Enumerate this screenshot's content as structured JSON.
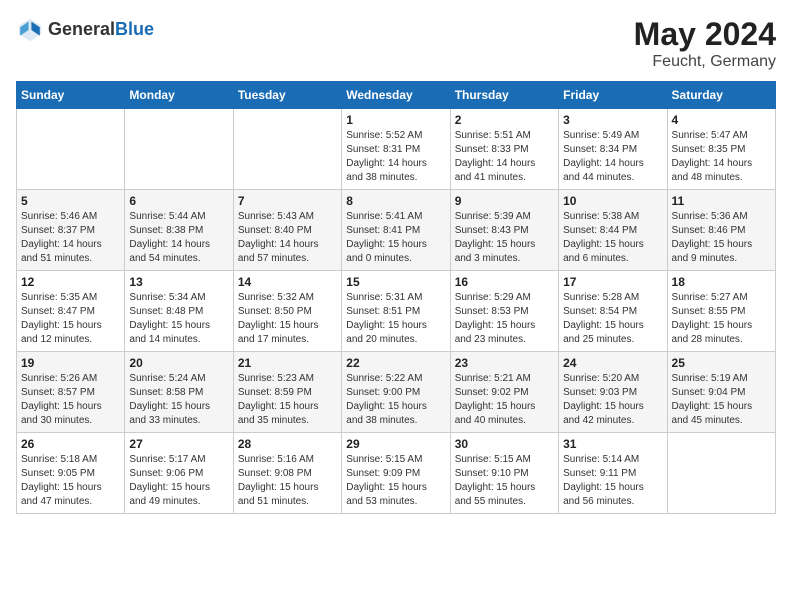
{
  "header": {
    "logo_general": "General",
    "logo_blue": "Blue",
    "title": "May 2024",
    "location": "Feucht, Germany"
  },
  "weekdays": [
    "Sunday",
    "Monday",
    "Tuesday",
    "Wednesday",
    "Thursday",
    "Friday",
    "Saturday"
  ],
  "weeks": [
    [
      {
        "day": "",
        "info": ""
      },
      {
        "day": "",
        "info": ""
      },
      {
        "day": "",
        "info": ""
      },
      {
        "day": "1",
        "info": "Sunrise: 5:52 AM\nSunset: 8:31 PM\nDaylight: 14 hours\nand 38 minutes."
      },
      {
        "day": "2",
        "info": "Sunrise: 5:51 AM\nSunset: 8:33 PM\nDaylight: 14 hours\nand 41 minutes."
      },
      {
        "day": "3",
        "info": "Sunrise: 5:49 AM\nSunset: 8:34 PM\nDaylight: 14 hours\nand 44 minutes."
      },
      {
        "day": "4",
        "info": "Sunrise: 5:47 AM\nSunset: 8:35 PM\nDaylight: 14 hours\nand 48 minutes."
      }
    ],
    [
      {
        "day": "5",
        "info": "Sunrise: 5:46 AM\nSunset: 8:37 PM\nDaylight: 14 hours\nand 51 minutes."
      },
      {
        "day": "6",
        "info": "Sunrise: 5:44 AM\nSunset: 8:38 PM\nDaylight: 14 hours\nand 54 minutes."
      },
      {
        "day": "7",
        "info": "Sunrise: 5:43 AM\nSunset: 8:40 PM\nDaylight: 14 hours\nand 57 minutes."
      },
      {
        "day": "8",
        "info": "Sunrise: 5:41 AM\nSunset: 8:41 PM\nDaylight: 15 hours\nand 0 minutes."
      },
      {
        "day": "9",
        "info": "Sunrise: 5:39 AM\nSunset: 8:43 PM\nDaylight: 15 hours\nand 3 minutes."
      },
      {
        "day": "10",
        "info": "Sunrise: 5:38 AM\nSunset: 8:44 PM\nDaylight: 15 hours\nand 6 minutes."
      },
      {
        "day": "11",
        "info": "Sunrise: 5:36 AM\nSunset: 8:46 PM\nDaylight: 15 hours\nand 9 minutes."
      }
    ],
    [
      {
        "day": "12",
        "info": "Sunrise: 5:35 AM\nSunset: 8:47 PM\nDaylight: 15 hours\nand 12 minutes."
      },
      {
        "day": "13",
        "info": "Sunrise: 5:34 AM\nSunset: 8:48 PM\nDaylight: 15 hours\nand 14 minutes."
      },
      {
        "day": "14",
        "info": "Sunrise: 5:32 AM\nSunset: 8:50 PM\nDaylight: 15 hours\nand 17 minutes."
      },
      {
        "day": "15",
        "info": "Sunrise: 5:31 AM\nSunset: 8:51 PM\nDaylight: 15 hours\nand 20 minutes."
      },
      {
        "day": "16",
        "info": "Sunrise: 5:29 AM\nSunset: 8:53 PM\nDaylight: 15 hours\nand 23 minutes."
      },
      {
        "day": "17",
        "info": "Sunrise: 5:28 AM\nSunset: 8:54 PM\nDaylight: 15 hours\nand 25 minutes."
      },
      {
        "day": "18",
        "info": "Sunrise: 5:27 AM\nSunset: 8:55 PM\nDaylight: 15 hours\nand 28 minutes."
      }
    ],
    [
      {
        "day": "19",
        "info": "Sunrise: 5:26 AM\nSunset: 8:57 PM\nDaylight: 15 hours\nand 30 minutes."
      },
      {
        "day": "20",
        "info": "Sunrise: 5:24 AM\nSunset: 8:58 PM\nDaylight: 15 hours\nand 33 minutes."
      },
      {
        "day": "21",
        "info": "Sunrise: 5:23 AM\nSunset: 8:59 PM\nDaylight: 15 hours\nand 35 minutes."
      },
      {
        "day": "22",
        "info": "Sunrise: 5:22 AM\nSunset: 9:00 PM\nDaylight: 15 hours\nand 38 minutes."
      },
      {
        "day": "23",
        "info": "Sunrise: 5:21 AM\nSunset: 9:02 PM\nDaylight: 15 hours\nand 40 minutes."
      },
      {
        "day": "24",
        "info": "Sunrise: 5:20 AM\nSunset: 9:03 PM\nDaylight: 15 hours\nand 42 minutes."
      },
      {
        "day": "25",
        "info": "Sunrise: 5:19 AM\nSunset: 9:04 PM\nDaylight: 15 hours\nand 45 minutes."
      }
    ],
    [
      {
        "day": "26",
        "info": "Sunrise: 5:18 AM\nSunset: 9:05 PM\nDaylight: 15 hours\nand 47 minutes."
      },
      {
        "day": "27",
        "info": "Sunrise: 5:17 AM\nSunset: 9:06 PM\nDaylight: 15 hours\nand 49 minutes."
      },
      {
        "day": "28",
        "info": "Sunrise: 5:16 AM\nSunset: 9:08 PM\nDaylight: 15 hours\nand 51 minutes."
      },
      {
        "day": "29",
        "info": "Sunrise: 5:15 AM\nSunset: 9:09 PM\nDaylight: 15 hours\nand 53 minutes."
      },
      {
        "day": "30",
        "info": "Sunrise: 5:15 AM\nSunset: 9:10 PM\nDaylight: 15 hours\nand 55 minutes."
      },
      {
        "day": "31",
        "info": "Sunrise: 5:14 AM\nSunset: 9:11 PM\nDaylight: 15 hours\nand 56 minutes."
      },
      {
        "day": "",
        "info": ""
      }
    ]
  ]
}
